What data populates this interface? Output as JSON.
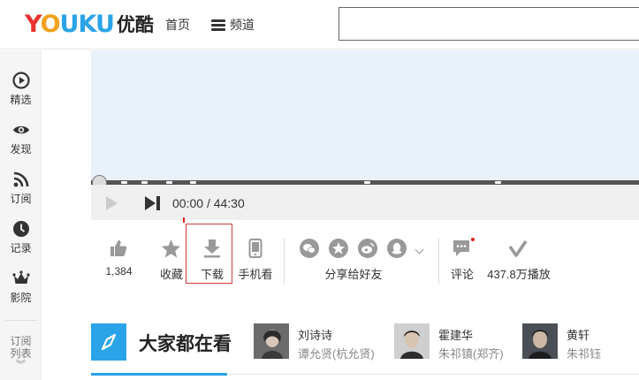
{
  "header": {
    "logo_letters": [
      {
        "ch": "Y",
        "color": "#e8322f"
      },
      {
        "ch": "O",
        "color": "#f0a21e"
      },
      {
        "ch": "U",
        "color": "#2aa3e8"
      },
      {
        "ch": "K",
        "color": "#2aa3e8"
      },
      {
        "ch": "U",
        "color": "#2aa3e8"
      }
    ],
    "logo_cn": "优酷",
    "nav_home": "首页",
    "nav_channel": "频道",
    "search_value": ""
  },
  "sidebar": {
    "items": [
      {
        "label": "精选",
        "icon": "play-circle-icon"
      },
      {
        "label": "发现",
        "icon": "eye-icon"
      },
      {
        "label": "订阅",
        "icon": "rss-icon"
      },
      {
        "label": "记录",
        "icon": "clock-icon"
      },
      {
        "label": "影院",
        "icon": "crown-icon"
      }
    ],
    "subscribe_label_1": "订阅",
    "subscribe_label_2": "列表",
    "expand_glyph": "︾"
  },
  "player": {
    "time_current": "00:00",
    "time_separator": "/",
    "time_total": "44:30",
    "progress": 0
  },
  "actions": {
    "like_count": "1,384",
    "collect": "收藏",
    "download": "下载",
    "mobile": "手机看",
    "share_friends": "分享给好友",
    "comment": "评论",
    "plays": "437.8万播放"
  },
  "section": {
    "title": "大家都在看",
    "actors": [
      {
        "name": "刘诗诗",
        "role": "谭允贤(杭允贤)"
      },
      {
        "name": "霍建华",
        "role": "朱祁镇(郑齐)"
      },
      {
        "name": "黄轩",
        "role": "朱祁钰"
      }
    ]
  },
  "colors": {
    "accent": "#2aa3e8",
    "video_bg": "#e9f2fb",
    "highlight_border": "#d43a3a"
  }
}
